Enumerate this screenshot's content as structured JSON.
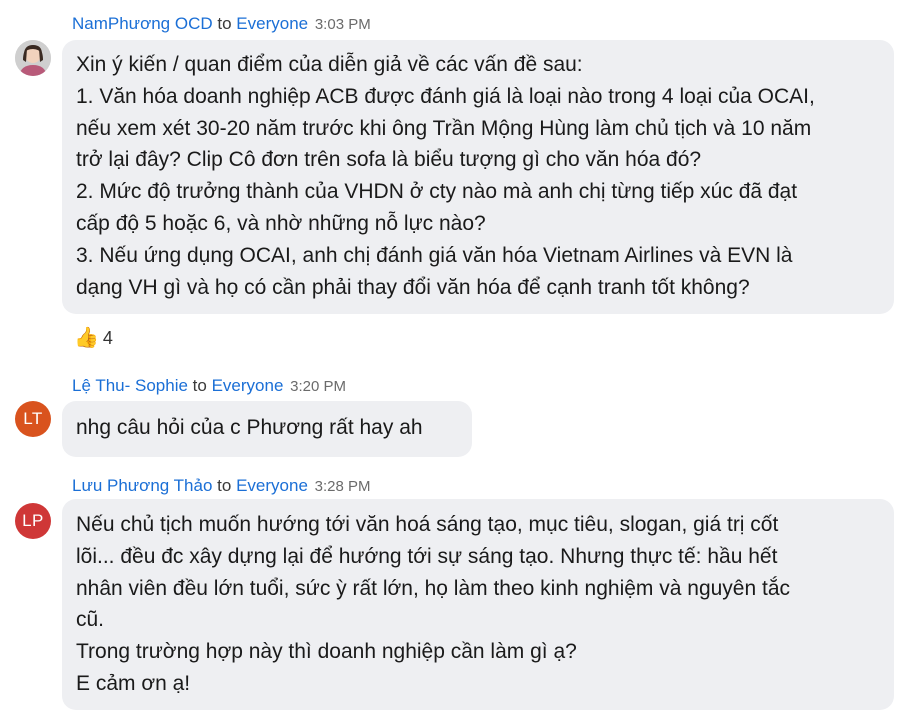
{
  "messages": [
    {
      "sender": "NamPhương OCD",
      "to_word": "to",
      "recipient": "Everyone",
      "time": "3:03 PM",
      "avatar": {
        "type": "photo",
        "initials": ""
      },
      "lines": [
        "Xin ý kiến / quan điểm của diễn giả về các vấn đề sau:",
        "1. Văn hóa doanh nghiệp ACB được đánh giá là loại nào trong 4 loại của OCAI,",
        "nếu xem xét 30-20 năm trước khi ông Trần Mộng Hùng làm chủ tịch và 10 năm",
        "trở lại đây? Clip Cô đơn trên sofa là biểu tượng gì cho văn hóa đó?",
        "2. Mức độ trưởng thành của VHDN ở cty nào mà anh chị từng tiếp xúc đã đạt",
        "cấp độ 5 hoặc 6, và nhờ những nỗ  lực nào?",
        "3. Nếu ứng dụng OCAI, anh chị đánh giá văn hóa Vietnam Airlines và EVN là",
        "dạng VH gì và họ có cần phải thay đổi văn hóa để cạnh tranh tốt không?"
      ],
      "reaction": {
        "icon": "thumbs-up-icon",
        "glyph": "👍",
        "count": "4"
      }
    },
    {
      "sender": "Lệ Thu- Sophie",
      "to_word": "to",
      "recipient": "Everyone",
      "time": "3:20 PM",
      "avatar": {
        "type": "initials",
        "initials": "LT",
        "color": "#d9531e"
      },
      "lines": [
        "nhg câu hỏi của c Phương rất hay ah"
      ]
    },
    {
      "sender": "Lưu Phương Thảo",
      "to_word": "to",
      "recipient": "Everyone",
      "time": "3:28 PM",
      "avatar": {
        "type": "initials",
        "initials": "LP",
        "color": "#cf3737"
      },
      "lines": [
        "Nếu chủ tịch muốn hướng tới văn hoá sáng tạo, mục tiêu, slogan, giá trị cốt",
        "lõi... đều đc xây dựng lại để hướng tới sự sáng tạo. Nhưng thực tế: hầu hết",
        "nhân viên đều lớn tuổi, sức ỳ rất lớn, họ làm theo kinh nghiệm và nguyên tắc",
        "cũ.",
        "Trong trường hợp này thì doanh nghiệp cần làm gì ạ?",
        "E cảm ơn ạ!"
      ]
    }
  ],
  "colors": {
    "sender": "#1b6fd6",
    "bubble": "#eeeff2",
    "text": "#1a1a1a",
    "time": "#6b6b6b"
  }
}
